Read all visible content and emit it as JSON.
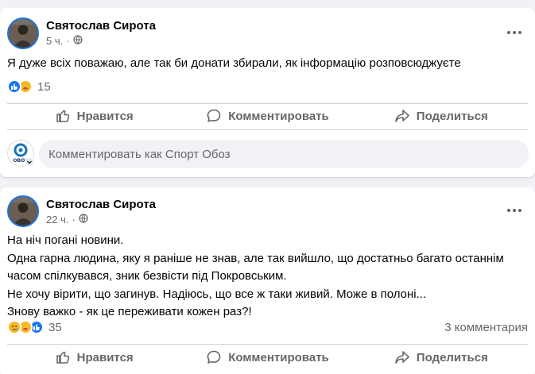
{
  "posts": [
    {
      "author": "Святослав Сирота",
      "time": "5 ч.",
      "privacy_icon": "globe-icon",
      "text_lines": [
        "Я дуже всіх поважаю, але так би донати збирали, як інформацію розповсюджуєте"
      ],
      "reactions": {
        "icons": [
          "like",
          "care"
        ],
        "count": "15"
      },
      "actions": {
        "like": "Нравится",
        "comment": "Комментировать",
        "share": "Поделиться"
      },
      "comment_box": {
        "placeholder": "Комментировать как Спорт Обоз",
        "page_avatar_label": "OBOZ"
      }
    },
    {
      "author": "Святослав Сирота",
      "time": "22 ч.",
      "privacy_icon": "globe-icon",
      "text_lines": [
        "На ніч погані новини.",
        "Одна гарна людина, яку я раніше не знав, але так вийшло, що достатньо багато останнім",
        "часом спілкувався, зник безвісти під Покровським.",
        "Не хочу вірити, що загинув. Надіюсь, що все ж таки живий. Може в полоні...",
        "Знову важко - як це переживати кожен раз?!"
      ],
      "reactions": {
        "icons": [
          "sad",
          "care",
          "like"
        ],
        "count": "35"
      },
      "comments_count": "3 комментария",
      "actions": {
        "like": "Нравится",
        "comment": "Комментировать",
        "share": "Поделиться"
      }
    }
  ],
  "colors": {
    "accent": "#1b74e4",
    "like": "#1877f2",
    "care": "#f7b928",
    "muted": "#65676b"
  }
}
